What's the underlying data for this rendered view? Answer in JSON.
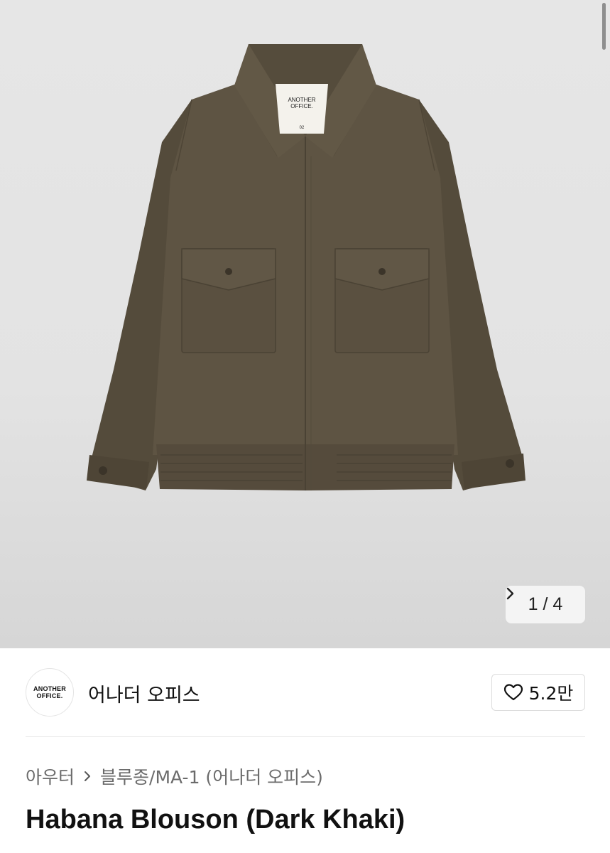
{
  "gallery": {
    "current": "1",
    "separator": "/",
    "total": "4"
  },
  "brand": {
    "logo_line1": "ANOTHER",
    "logo_line2": "OFFICE.",
    "name": "어나더 오피스",
    "like_count": "5.2만"
  },
  "jacket_label": {
    "line1": "ANOTHER",
    "line2": "OFFICE.",
    "size": "02"
  },
  "breadcrumb": {
    "category": "아우터",
    "subcategory": "블루종/MA-1 (어나더 오피스)"
  },
  "product": {
    "title": "Habana Blouson (Dark Khaki)"
  },
  "colors": {
    "jacket": "#5e5443",
    "background": "#e3e3e3"
  }
}
